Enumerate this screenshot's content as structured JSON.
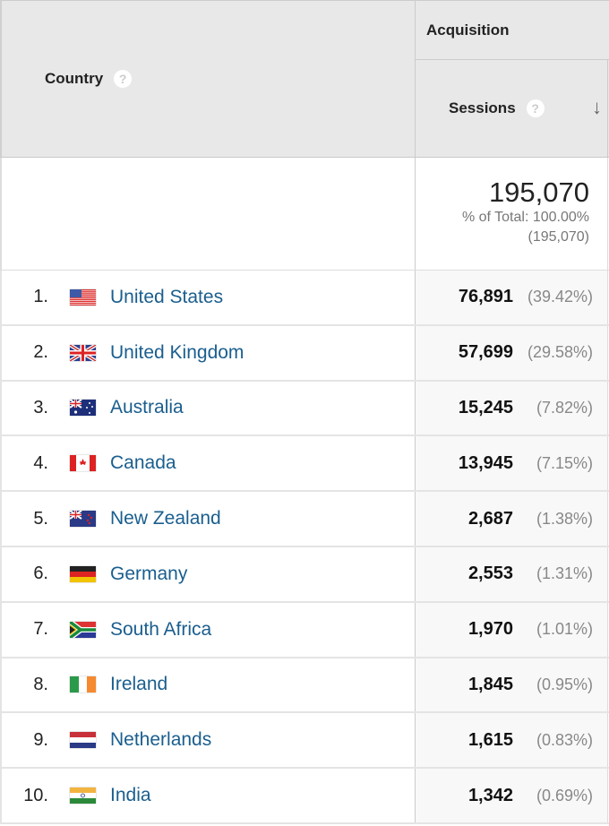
{
  "header": {
    "country_label": "Country",
    "group_label": "Acquisition",
    "sessions_label": "Sessions",
    "help_glyph": "?",
    "sort_glyph": "↓"
  },
  "total": {
    "value": "195,070",
    "pct_label": "% of Total: 100.00%",
    "abs_label": "(195,070)"
  },
  "rows": [
    {
      "rank": "1.",
      "country": "United States",
      "flag": "us-flag-icon",
      "sessions": "76,891",
      "pct": "(39.42%)"
    },
    {
      "rank": "2.",
      "country": "United Kingdom",
      "flag": "uk-flag-icon",
      "sessions": "57,699",
      "pct": "(29.58%)"
    },
    {
      "rank": "3.",
      "country": "Australia",
      "flag": "au-flag-icon",
      "sessions": "15,245",
      "pct": "(7.82%)"
    },
    {
      "rank": "4.",
      "country": "Canada",
      "flag": "ca-flag-icon",
      "sessions": "13,945",
      "pct": "(7.15%)"
    },
    {
      "rank": "5.",
      "country": "New Zealand",
      "flag": "nz-flag-icon",
      "sessions": "2,687",
      "pct": "(1.38%)"
    },
    {
      "rank": "6.",
      "country": "Germany",
      "flag": "de-flag-icon",
      "sessions": "2,553",
      "pct": "(1.31%)"
    },
    {
      "rank": "7.",
      "country": "South Africa",
      "flag": "za-flag-icon",
      "sessions": "1,970",
      "pct": "(1.01%)"
    },
    {
      "rank": "8.",
      "country": "Ireland",
      "flag": "ie-flag-icon",
      "sessions": "1,845",
      "pct": "(0.95%)"
    },
    {
      "rank": "9.",
      "country": "Netherlands",
      "flag": "nl-flag-icon",
      "sessions": "1,615",
      "pct": "(0.83%)"
    },
    {
      "rank": "10.",
      "country": "India",
      "flag": "in-flag-icon",
      "sessions": "1,342",
      "pct": "(0.69%)"
    }
  ]
}
